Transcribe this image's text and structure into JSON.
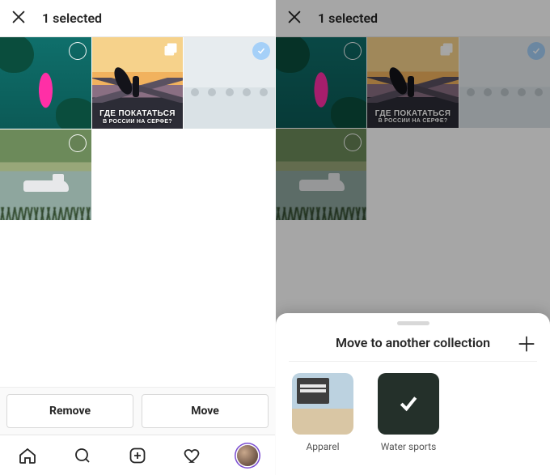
{
  "header": {
    "title": "1 selected"
  },
  "tiles": {
    "surf_overlay_line1": "ГДЕ ПОКАТАТЬСЯ",
    "surf_overlay_line2": "В РОССИИ НА СЕРФЕ?"
  },
  "actions": {
    "remove": "Remove",
    "move": "Move"
  },
  "sheet": {
    "title": "Move to another collection",
    "collections": [
      {
        "label": "Apparel",
        "selected": false
      },
      {
        "label": "Water sports",
        "selected": true
      }
    ]
  },
  "icons": {
    "close": "close-icon",
    "home": "home-icon",
    "search": "search-icon",
    "add": "add-post-icon",
    "heart": "heart-icon",
    "profile": "profile-avatar",
    "plus": "plus-icon",
    "multi": "multi-post-icon",
    "check": "check-icon"
  }
}
